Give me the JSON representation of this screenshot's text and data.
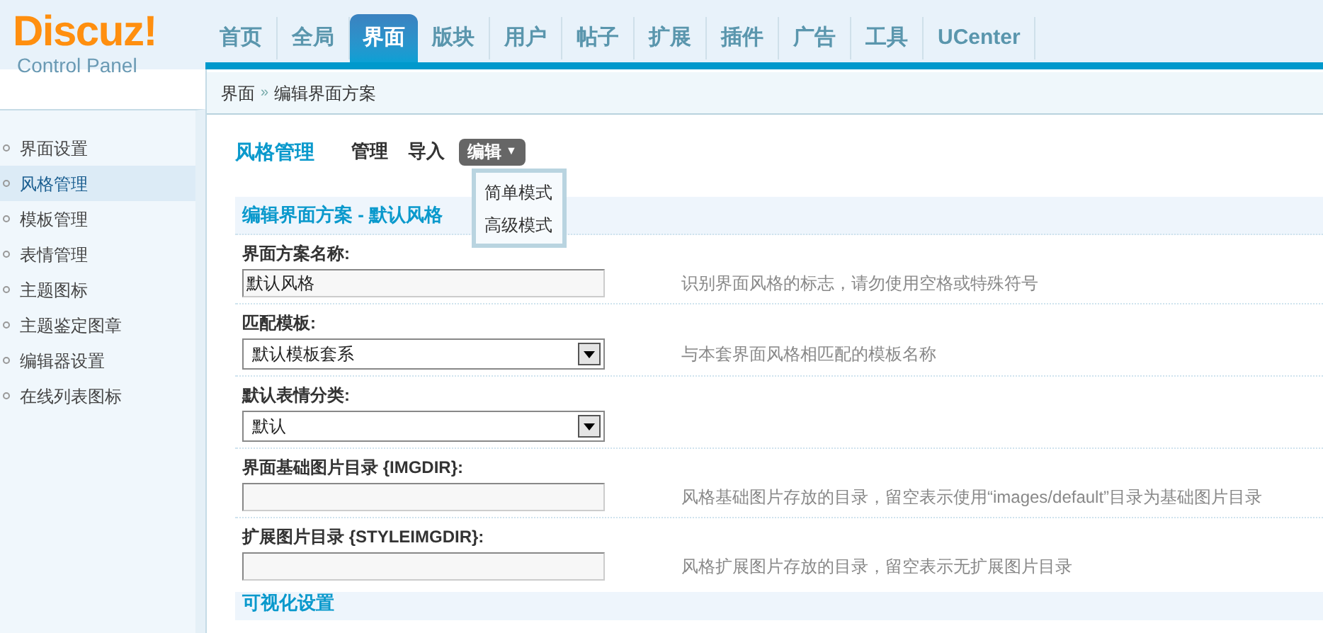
{
  "logo": {
    "name": "Discuz!",
    "subtitle": "Control Panel"
  },
  "nav": [
    {
      "label": "首页",
      "selected": false
    },
    {
      "label": "全局",
      "selected": false
    },
    {
      "label": "界面",
      "selected": true
    },
    {
      "label": "版块",
      "selected": false
    },
    {
      "label": "用户",
      "selected": false
    },
    {
      "label": "帖子",
      "selected": false
    },
    {
      "label": "扩展",
      "selected": false
    },
    {
      "label": "插件",
      "selected": false
    },
    {
      "label": "广告",
      "selected": false
    },
    {
      "label": "工具",
      "selected": false
    },
    {
      "label": "UCenter",
      "selected": false
    }
  ],
  "breadcrumb": [
    "界面",
    "»",
    "编辑界面方案"
  ],
  "sidebar": {
    "items": [
      {
        "label": "界面设置",
        "selected": false
      },
      {
        "label": "风格管理",
        "selected": true
      },
      {
        "label": "模板管理",
        "selected": false
      },
      {
        "label": "表情管理",
        "selected": false
      },
      {
        "label": "主题图标",
        "selected": false
      },
      {
        "label": "主题鉴定图章",
        "selected": false
      },
      {
        "label": "编辑器设置",
        "selected": false
      },
      {
        "label": "在线列表图标",
        "selected": false
      }
    ]
  },
  "page_title": "风格管理",
  "subtabs": [
    {
      "label": "管理",
      "selected": false
    },
    {
      "label": "导入",
      "selected": false
    },
    {
      "label": "编辑",
      "selected": true,
      "caret": "▼"
    }
  ],
  "dropdown": [
    "简单模式",
    "高级模式"
  ],
  "section_title": "编辑界面方案 - 默认风格",
  "fields": [
    {
      "kind": "text",
      "label": "界面方案名称:",
      "value": "默认风格",
      "hint": "识别界面风格的标志，请勿使用空格或特殊符号"
    },
    {
      "kind": "select",
      "label": "匹配模板:",
      "value": "默认模板套系",
      "hint": "与本套界面风格相匹配的模板名称"
    },
    {
      "kind": "select",
      "label": "默认表情分类:",
      "value": "默认"
    },
    {
      "kind": "text",
      "label": "界面基础图片目录 {IMGDIR}:",
      "hint": "风格基础图片存放的目录，留空表示使用“images/default”目录为基础图片目录"
    },
    {
      "kind": "text",
      "label": "扩展图片目录 {STYLEIMGDIR}:",
      "hint": "风格扩展图片存放的目录，留空表示无扩展图片目录"
    }
  ],
  "next_section_title": "可视化设置"
}
